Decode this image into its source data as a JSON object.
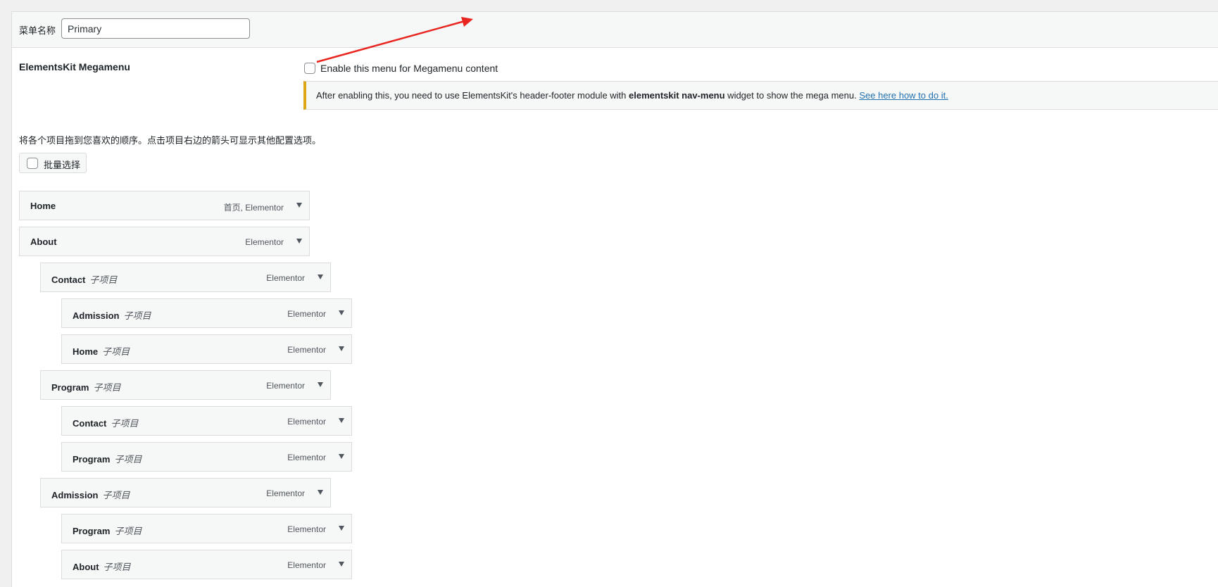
{
  "header": {
    "menu_name_label": "菜单名称",
    "menu_name_value": "Primary"
  },
  "megamenu": {
    "label": "ElementsKit Megamenu",
    "checkbox_label": "Enable this menu for Megamenu content",
    "notice_before": "After enabling this, you need to use ElementsKit's header-footer module with ",
    "notice_bold": "elementskit nav-menu",
    "notice_after": " widget to show the mega menu. ",
    "notice_link": "See here how to do it."
  },
  "instructions": "将各个项目拖到您喜欢的顺序。点击项目右边的箭头可显示其他配置选项。",
  "bulk_select_label": "批量选择",
  "menu_items": [
    {
      "title": "Home",
      "sub": "",
      "type": "首页, Elementor",
      "depth": 0
    },
    {
      "title": "About",
      "sub": "",
      "type": "Elementor",
      "depth": 0
    },
    {
      "title": "Contact",
      "sub": "子项目",
      "type": "Elementor",
      "depth": 1
    },
    {
      "title": "Admission",
      "sub": "子项目",
      "type": "Elementor",
      "depth": 2
    },
    {
      "title": "Home",
      "sub": "子项目",
      "type": "Elementor",
      "depth": 2
    },
    {
      "title": "Program",
      "sub": "子项目",
      "type": "Elementor",
      "depth": 1
    },
    {
      "title": "Contact",
      "sub": "子项目",
      "type": "Elementor",
      "depth": 2
    },
    {
      "title": "Program",
      "sub": "子项目",
      "type": "Elementor",
      "depth": 2
    },
    {
      "title": "Admission",
      "sub": "子项目",
      "type": "Elementor",
      "depth": 1
    },
    {
      "title": "Program",
      "sub": "子项目",
      "type": "Elementor",
      "depth": 2
    },
    {
      "title": "About",
      "sub": "子项目",
      "type": "Elementor",
      "depth": 2
    }
  ],
  "colors": {
    "notice_border": "#dba617",
    "link": "#2271b1",
    "annotation_arrow": "#e8261f"
  }
}
